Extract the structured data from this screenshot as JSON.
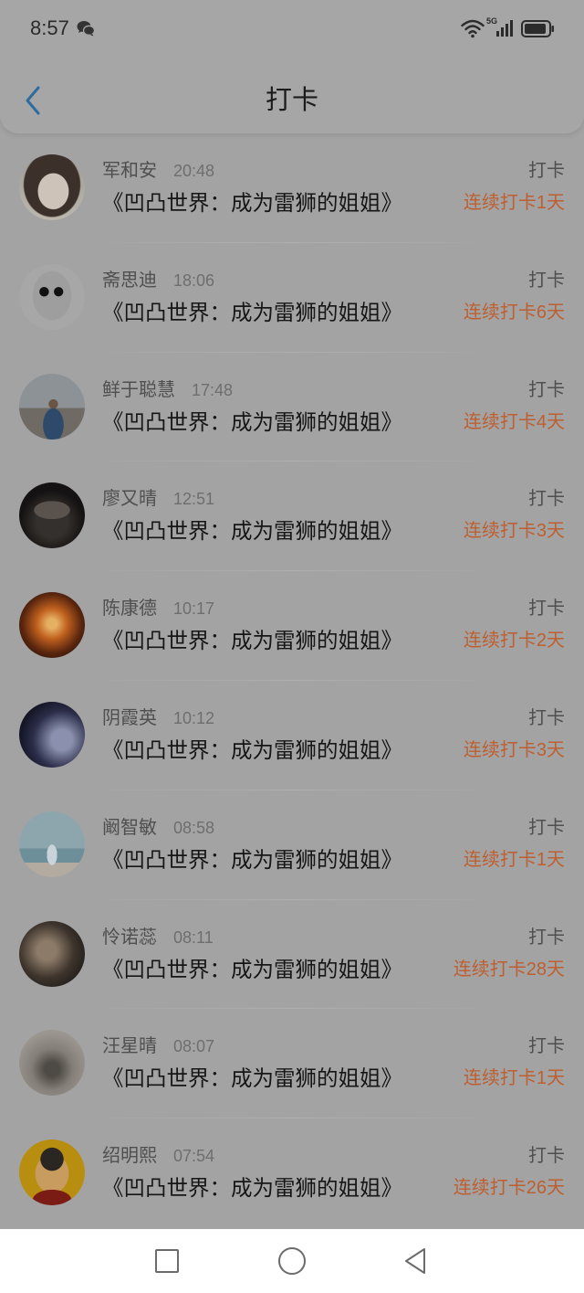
{
  "status_bar": {
    "time": "8:57",
    "network_type": "5G",
    "icons": [
      "wechat-icon",
      "wifi-icon",
      "signal-icon",
      "battery-icon"
    ]
  },
  "header": {
    "title": "打卡",
    "back_icon": "chevron-left-icon"
  },
  "checkins": [
    {
      "name": "军和安",
      "time": "20:48",
      "title": "《凹凸世界：成为雷狮的姐姐》",
      "action": "打卡",
      "streak": "连续打卡1天"
    },
    {
      "name": "斋思迪",
      "time": "18:06",
      "title": "《凹凸世界：成为雷狮的姐姐》",
      "action": "打卡",
      "streak": "连续打卡6天"
    },
    {
      "name": "鲜于聪慧",
      "time": "17:48",
      "title": "《凹凸世界：成为雷狮的姐姐》",
      "action": "打卡",
      "streak": "连续打卡4天"
    },
    {
      "name": "廖又晴",
      "time": "12:51",
      "title": "《凹凸世界：成为雷狮的姐姐》",
      "action": "打卡",
      "streak": "连续打卡3天"
    },
    {
      "name": "陈康德",
      "time": "10:17",
      "title": "《凹凸世界：成为雷狮的姐姐》",
      "action": "打卡",
      "streak": "连续打卡2天"
    },
    {
      "name": "阴霞英",
      "time": "10:12",
      "title": "《凹凸世界：成为雷狮的姐姐》",
      "action": "打卡",
      "streak": "连续打卡3天"
    },
    {
      "name": "阚智敏",
      "time": "08:58",
      "title": "《凹凸世界：成为雷狮的姐姐》",
      "action": "打卡",
      "streak": "连续打卡1天"
    },
    {
      "name": "怜诺蕊",
      "time": "08:11",
      "title": "《凹凸世界：成为雷狮的姐姐》",
      "action": "打卡",
      "streak": "连续打卡28天"
    },
    {
      "name": "汪星晴",
      "time": "08:07",
      "title": "《凹凸世界：成为雷狮的姐姐》",
      "action": "打卡",
      "streak": "连续打卡1天"
    },
    {
      "name": "绍明熙",
      "time": "07:54",
      "title": "《凹凸世界：成为雷狮的姐姐》",
      "action": "打卡",
      "streak": "连续打卡26天"
    }
  ],
  "nav_bar": {
    "icons": [
      "recent-apps-square-icon",
      "home-circle-icon",
      "back-triangle-icon"
    ]
  },
  "colors": {
    "dimmed_background": "#a3a3a3",
    "streak_text": "#bd5f30",
    "back_arrow": "#2d6c9c",
    "nav_bar_background": "#ffffff"
  }
}
